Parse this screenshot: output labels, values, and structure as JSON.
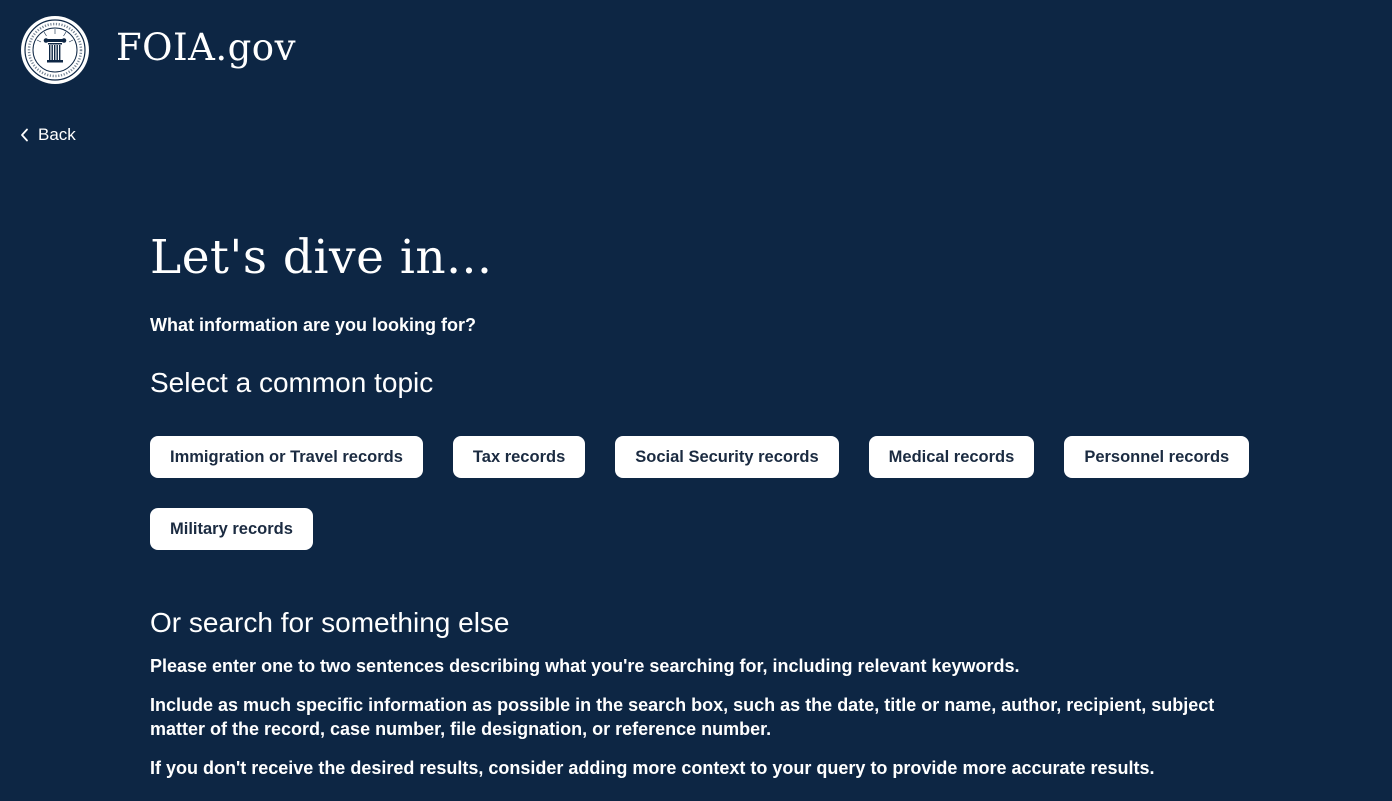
{
  "header": {
    "site_title": "FOIA.gov",
    "logo_icon": "foia-seal-icon"
  },
  "nav": {
    "back_label": "Back",
    "back_icon": "chevron-left-icon"
  },
  "main": {
    "title": "Let's dive in...",
    "question": "What information are you looking for?",
    "topics_heading": "Select a common topic",
    "topics": [
      "Immigration or Travel records",
      "Tax records",
      "Social Security records",
      "Medical records",
      "Personnel records",
      "Military records"
    ],
    "search_heading": "Or search for something else",
    "paragraphs": [
      "Please enter one to two sentences describing what you're searching for, including relevant keywords.",
      "Include as much specific information as possible in the search box, such as the date, title or name, author, recipient, subject matter of the record, case number, file designation, or reference number.",
      "If you don't receive the desired results, consider adding more context to your query to provide more accurate results."
    ]
  },
  "colors": {
    "background": "#0d2644",
    "button_background": "#ffffff",
    "button_text": "#1b2b41",
    "text": "#ffffff"
  }
}
